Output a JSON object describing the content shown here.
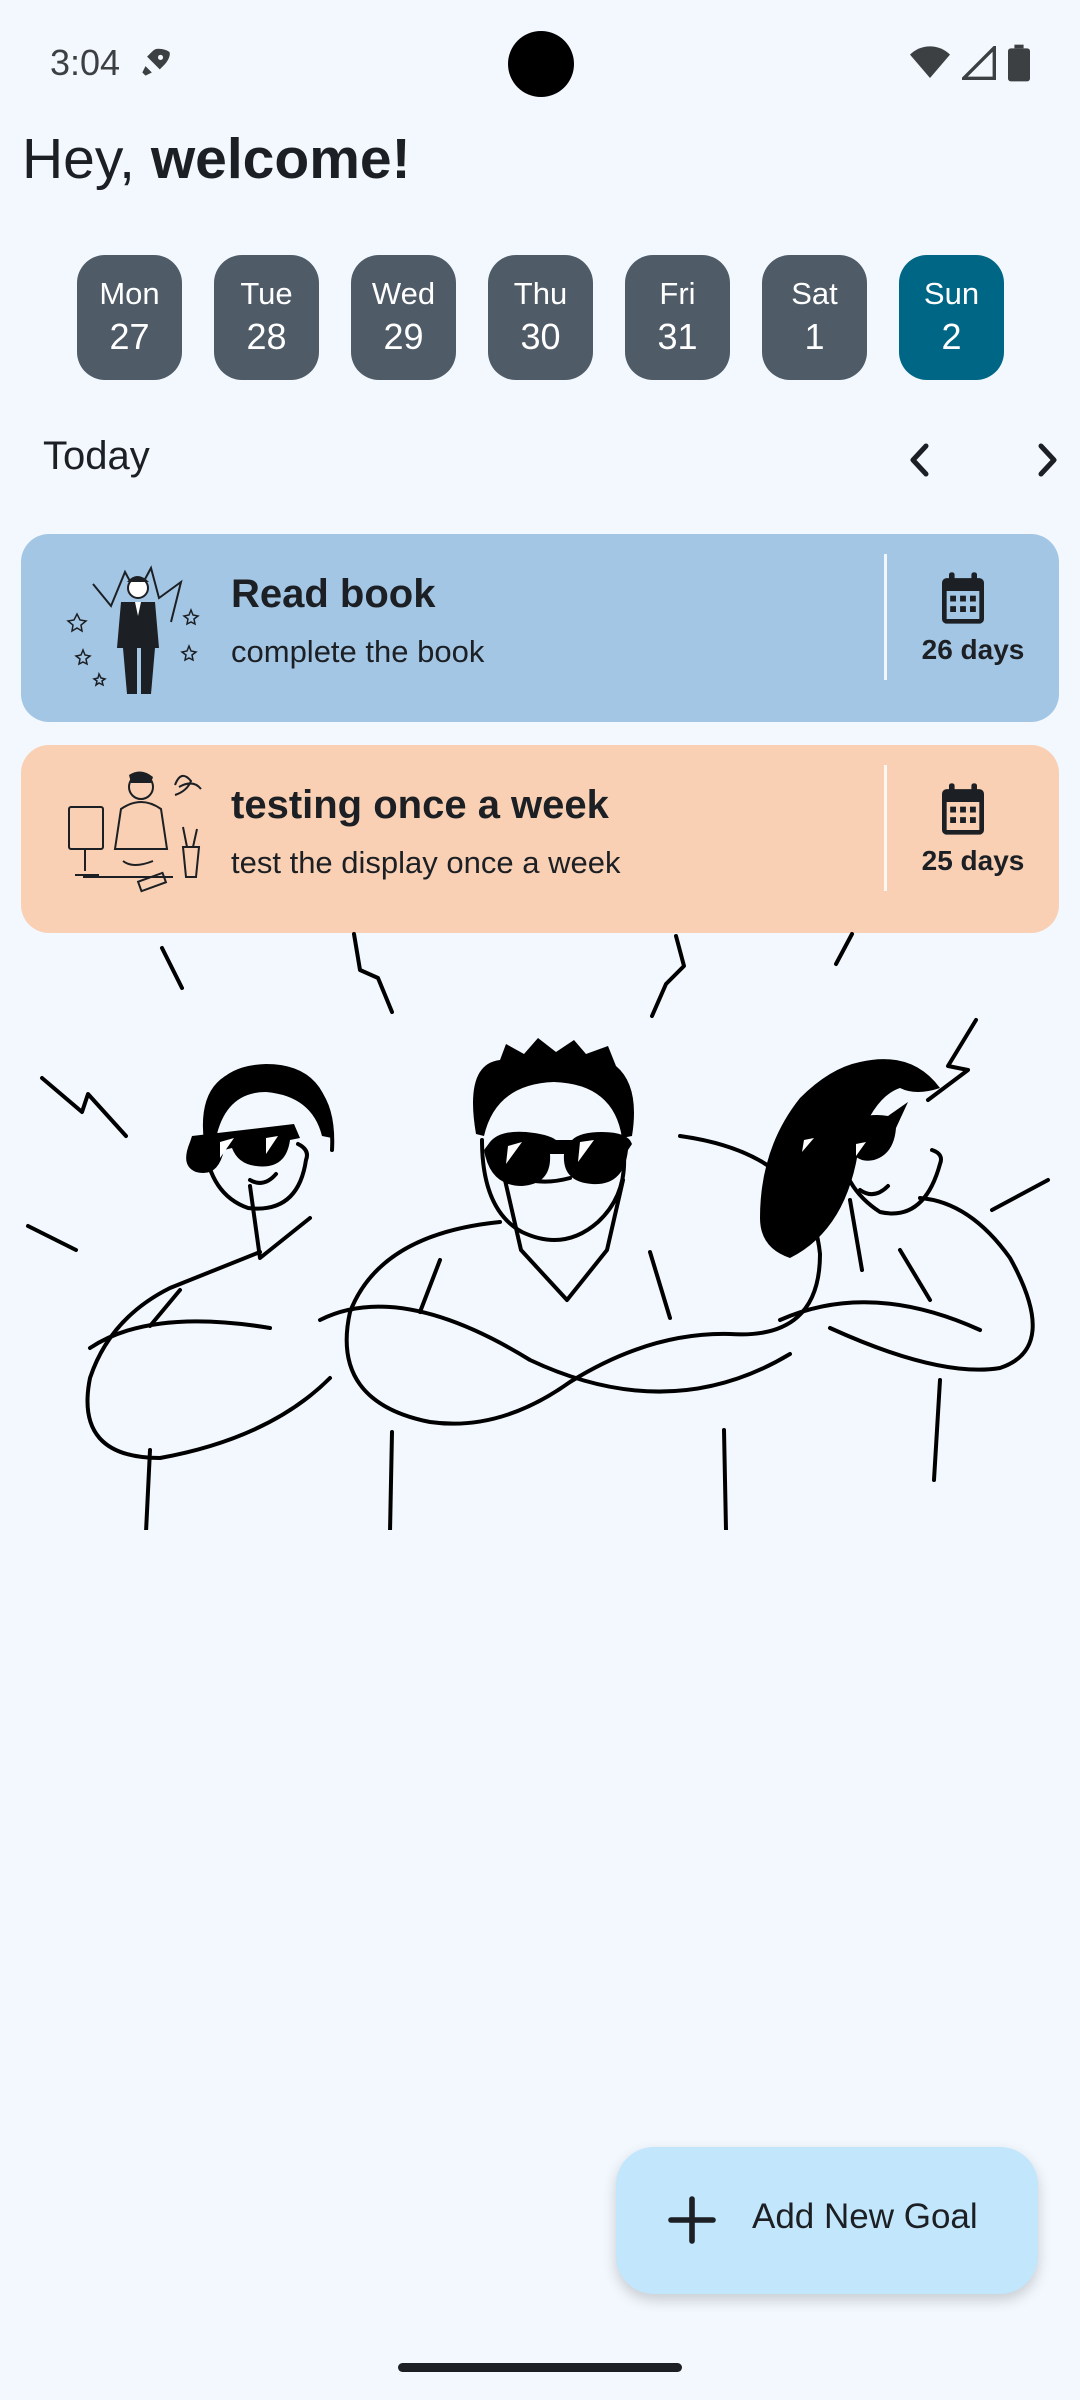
{
  "status_bar": {
    "time": "3:04"
  },
  "header": {
    "greeting_prefix": "Hey, ",
    "greeting_bold": "welcome!"
  },
  "days": [
    {
      "name": "Mon",
      "num": "27"
    },
    {
      "name": "Tue",
      "num": "28"
    },
    {
      "name": "Wed",
      "num": "29"
    },
    {
      "name": "Thu",
      "num": "30"
    },
    {
      "name": "Fri",
      "num": "31"
    },
    {
      "name": "Sat",
      "num": "1"
    },
    {
      "name": "Sun",
      "num": "2",
      "selected": true
    }
  ],
  "section": {
    "label": "Today"
  },
  "goals": [
    {
      "title": "Read book",
      "subtitle": "complete the book",
      "days": "26 days",
      "color": "#a3c6e4"
    },
    {
      "title": "testing once a week",
      "subtitle": "test the display once a week",
      "days": "25 days",
      "color": "#f9d0b4"
    }
  ],
  "fab": {
    "label": "Add New Goal"
  },
  "colors": {
    "background": "#f2f8fe",
    "day_chip": "#4f5b67",
    "day_chip_selected": "#006686",
    "fab": "#c2e6fb"
  },
  "icons": [
    "rocket-icon",
    "wifi-icon",
    "signal-icon",
    "battery-icon",
    "chevron-left-icon",
    "chevron-right-icon",
    "calendar-icon",
    "plus-icon"
  ]
}
